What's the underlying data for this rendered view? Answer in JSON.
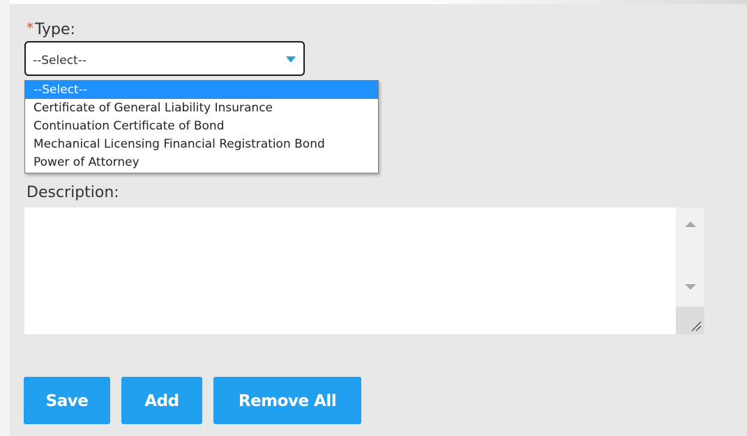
{
  "form": {
    "type_required_marker": "*",
    "type_label": "Type:",
    "type_select": {
      "selected_value": "--Select--",
      "options": [
        "--Select--",
        "Certificate of General Liability Insurance",
        "Continuation Certificate of Bond",
        "Mechanical Licensing Financial Registration Bond",
        "Power of Attorney"
      ],
      "highlighted_index": 0,
      "caret_color": "#2a9fd8",
      "highlight_color": "#1e90ff"
    },
    "description_label": "Description:",
    "description_value": ""
  },
  "buttons": {
    "save": "Save",
    "add": "Add",
    "remove_all": "Remove All",
    "color": "#21a0f0"
  }
}
